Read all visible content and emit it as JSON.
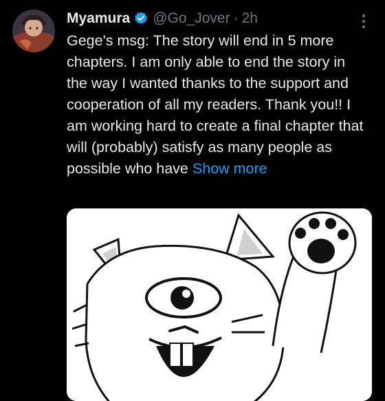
{
  "tweet": {
    "display_name": "Myamura",
    "handle": "@Go_Jover",
    "separator": "·",
    "time": "2h",
    "text": "Gege's msg: The story will end in 5 more chapters. I am only able to end the story in the way I wanted thanks to the support and cooperation of all my readers. Thank you!! I am working hard to create a final chapter that will (probably) satisfy as many people as possible who have",
    "show_more_label": "Show more",
    "media_icon": "cat-illustration-image"
  },
  "colors": {
    "background": "#000000",
    "text_primary": "#e7e9ea",
    "text_secondary": "#71767b",
    "link": "#1d9bf0",
    "verified_badge": "#1d9bf0"
  }
}
